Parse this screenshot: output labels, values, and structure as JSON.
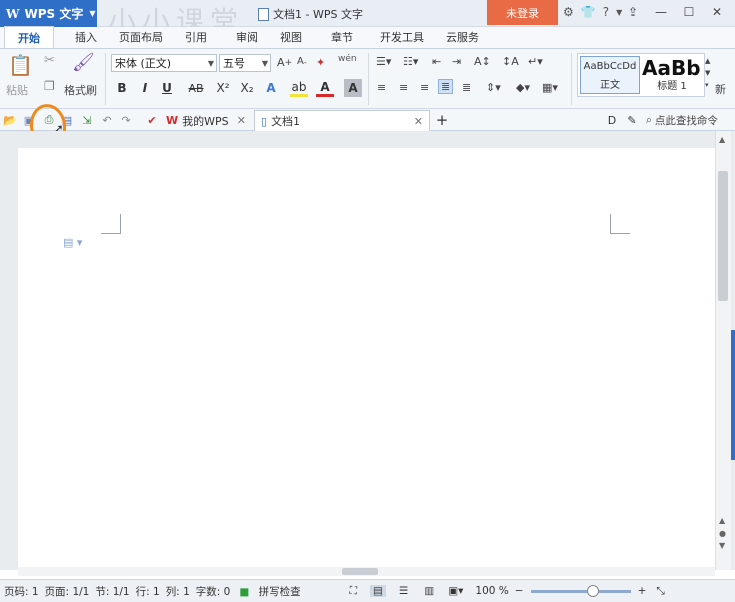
{
  "app": {
    "name": "WPS 文字",
    "watermark": "小小课堂"
  },
  "title": {
    "document": "文档1 - WPS 文字",
    "login": "未登录"
  },
  "menu": [
    "开始",
    "插入",
    "页面布局",
    "引用",
    "审阅",
    "视图",
    "章节",
    "开发工具",
    "云服务"
  ],
  "ribbon": {
    "paste": "粘贴",
    "format_painter": "格式刷",
    "font_name": "宋体 (正文)",
    "font_size": "五号",
    "bold": "B",
    "italic": "I",
    "underline": "U",
    "strike": "AB",
    "superscript": "X²",
    "subscript": "X₂",
    "style_normal_preview": "AaBbCcDd",
    "style_normal": "正文",
    "style_heading_preview": "AaBb",
    "style_heading": "标题 1",
    "new_style": "新"
  },
  "quickbar": {
    "tab_mywps": "我的WPS",
    "tab_doc": "文档1",
    "search": "点此查找命令"
  },
  "statusbar": {
    "page_num": "页码: 1",
    "pages": "页面: 1/1",
    "section": "节: 1/1",
    "row": "行: 1",
    "col": "列: 1",
    "words": "字数: 0",
    "spell": "拼写检查",
    "zoom": "100 %"
  },
  "colors": {
    "brand": "#2f6fc7",
    "login": "#e96b45",
    "highlight": "#f08a1c"
  }
}
